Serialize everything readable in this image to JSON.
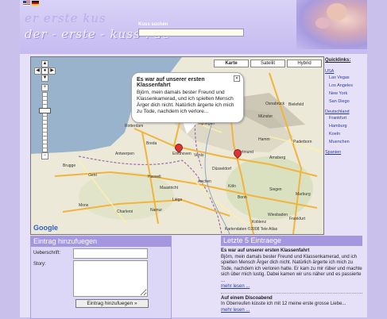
{
  "header": {
    "logo_ghost": "er  erste  kus",
    "logo": "der - erste - kuss . de",
    "search_label": "Kuss suchen",
    "search_value": ""
  },
  "map": {
    "types": {
      "map": "Karte",
      "satellite": "Satellit",
      "hybrid": "Hybrid"
    },
    "info_title": "Es war auf unserer ersten Klassenfahrt",
    "info_body": "Björn, mein damals bester Freund und Klassenkamerad, und ich spielten Mensch Ärger dich nicht. Natürlich ärgerte ich mich zu Tode, nachdem ich verlore...",
    "copyright": "Kartendaten ©2008 Tele Atlas",
    "google": "Google",
    "places": [
      "Rotterdam",
      "Breda",
      "Eindhoven",
      "Venlo",
      "Düsseldorf",
      "Dortmund",
      "Köln",
      "Bonn",
      "Aachen",
      "Maastricht",
      "Hasselt",
      "Namur",
      "Antwerpen",
      "Brugge",
      "Gent",
      "Charleroi",
      "Mons",
      "Bielefeld",
      "Münster",
      "Osnabrück",
      "Hamm",
      "Siegen",
      "Koblenz",
      "Marburg",
      "Frankfurt",
      "Wiesbaden",
      "Arnsberg",
      "Liège",
      "Utrecht",
      "Nijmegen",
      "Paderborn"
    ]
  },
  "quicklinks": {
    "title": "Quicklinks:",
    "groups": [
      {
        "country": "USA",
        "cities": [
          "Las Vegas",
          "Los Angeles",
          "New York",
          "San Diego"
        ]
      },
      {
        "country": "Deutschland",
        "cities": [
          "Frankfurt",
          "Hamburg",
          "Koeln",
          "Muenchen"
        ]
      },
      {
        "country": "Spanien",
        "cities": []
      }
    ]
  },
  "entry_form": {
    "header": "Eintrag hinzufuegen",
    "title_label": "Ueberschrift:",
    "story_label": "Story:",
    "submit": "Eintrag hinzufuegen »"
  },
  "latest": {
    "header": "Letzte 5 Eintraege",
    "entries": [
      {
        "title": "Es war auf unserer ersten Klassenfahrt",
        "text": "Björn, mein damals bester Freund und Klassenkamerad, und ich spielten Mensch Ärger dich nicht. Natürlich ärgerte ich mich zu Tode, nachdem ich verloren hatte. Er kam zu mir rüber und machte sich über mich lustig. Dabei kamen wir uns näher und es passierte ...",
        "more": "mehr lesen ..."
      },
      {
        "title": "Auf einem Discoabend",
        "text": "In Oberreufen küsste ich mit 12 meine erste grosse Liebe...",
        "more": "mehr lesen ..."
      }
    ]
  },
  "colors": {
    "header": "#c5bbf0",
    "panel_header": "#a497e0",
    "link": "#2a3c99"
  }
}
